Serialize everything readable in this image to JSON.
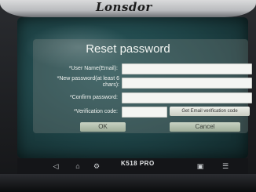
{
  "device": {
    "brand": "Lonsdor",
    "model": "K518 PRO"
  },
  "dialog": {
    "title": "Reset password",
    "fields": [
      {
        "label": "*User Name(Email):",
        "value": ""
      },
      {
        "label": "*New password(at least 6 chars):",
        "value": ""
      },
      {
        "label": "*Confirm password:",
        "value": ""
      },
      {
        "label": "*Verification code:",
        "value": ""
      }
    ],
    "get_code_label": "Get Email verification code",
    "ok_label": "OK",
    "cancel_label": "Cancel"
  },
  "navbar": {
    "icons": [
      "back-icon",
      "home-icon",
      "settings-icon",
      "screenshot-icon",
      "recent-apps-icon"
    ]
  }
}
